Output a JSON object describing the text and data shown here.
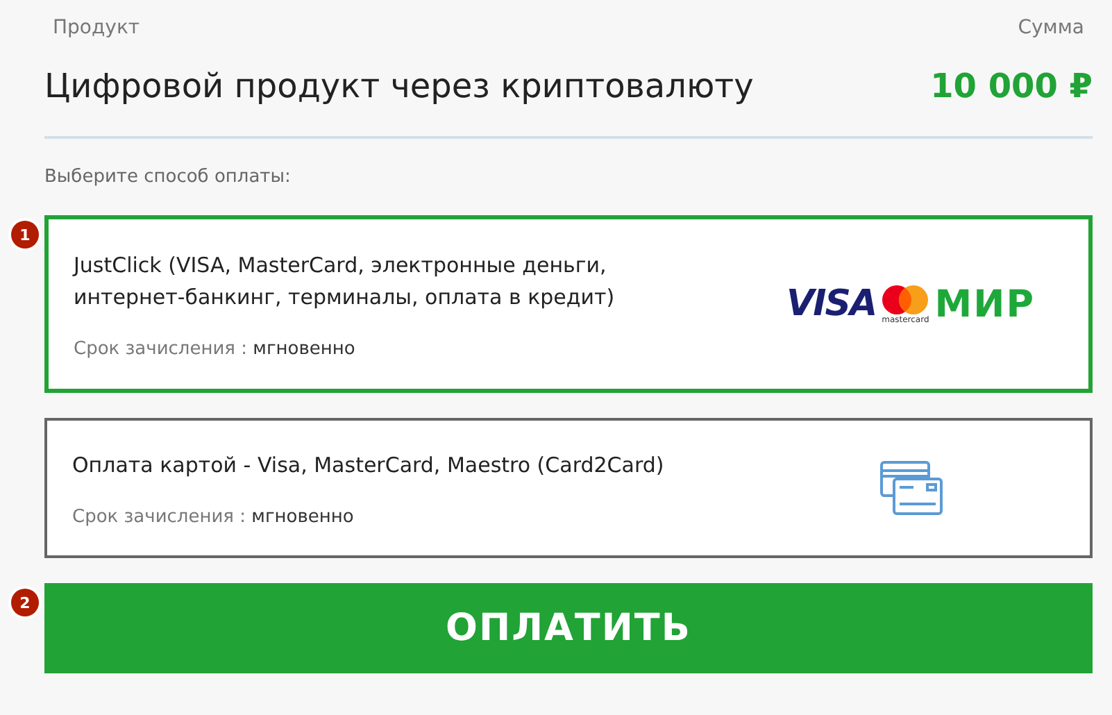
{
  "header": {
    "product_label": "Продукт",
    "amount_label": "Сумма",
    "product_name": "Цифровой продукт через криптовалюту",
    "amount": "10 000 ₽"
  },
  "prompt": "Выберите способ оплаты:",
  "methods": [
    {
      "badge": "1",
      "title": "JustClick (VISA, MasterCard, электронные деньги, интернет-банкинг, терминалы, оплата в кредит)",
      "term_label": "Срок зачисления :",
      "term_value": "мгновенно",
      "selected": true,
      "kind": "logos",
      "logos": {
        "visa": "VISA",
        "mastercard": "mastercard",
        "mir": "МИР"
      }
    },
    {
      "title": "Оплата картой - Visa, MasterCard, Maestro (Card2Card)",
      "term_label": "Срок зачисления :",
      "term_value": "мгновенно",
      "selected": false,
      "kind": "cards"
    }
  ],
  "pay_button": {
    "badge": "2",
    "label": "ОПЛАТИТЬ"
  }
}
